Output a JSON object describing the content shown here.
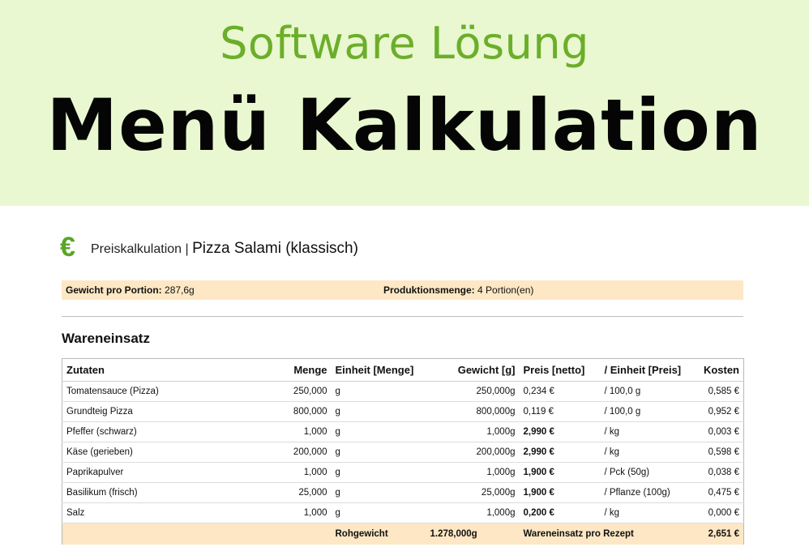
{
  "banner": {
    "subtitle": "Software Lösung",
    "title": "Menü Kalkulation"
  },
  "doc": {
    "icon": "euro-icon",
    "label": "Preiskalkulation",
    "separator": "|",
    "dish": "Pizza Salami (klassisch)"
  },
  "info": {
    "weight_label": "Gewicht pro Portion:",
    "weight_value": "287,6g",
    "production_label": "Produktionsmenge:",
    "production_value": "4 Portion(en)"
  },
  "section_title": "Wareneinsatz",
  "table": {
    "headers": [
      "Zutaten",
      "Menge",
      "Einheit [Menge]",
      "Gewicht [g]",
      "Preis [netto]",
      "/ Einheit [Preis]",
      "Kosten"
    ],
    "rows": [
      {
        "zutat": "Tomatensauce (Pizza)",
        "menge": "250,000",
        "einheit": "g",
        "gewicht": "250,000g",
        "preis": "0,234 €",
        "preis_bold": false,
        "einheit_preis": "/ 100,0 g",
        "kosten": "0,585 €"
      },
      {
        "zutat": "Grundteig Pizza",
        "menge": "800,000",
        "einheit": "g",
        "gewicht": "800,000g",
        "preis": "0,119 €",
        "preis_bold": false,
        "einheit_preis": "/ 100,0 g",
        "kosten": "0,952 €"
      },
      {
        "zutat": "Pfeffer (schwarz)",
        "menge": "1,000",
        "einheit": "g",
        "gewicht": "1,000g",
        "preis": "2,990 €",
        "preis_bold": true,
        "einheit_preis": "/ kg",
        "kosten": "0,003 €"
      },
      {
        "zutat": "Käse (gerieben)",
        "menge": "200,000",
        "einheit": "g",
        "gewicht": "200,000g",
        "preis": "2,990 €",
        "preis_bold": true,
        "einheit_preis": "/ kg",
        "kosten": "0,598 €"
      },
      {
        "zutat": "Paprikapulver",
        "menge": "1,000",
        "einheit": "g",
        "gewicht": "1,000g",
        "preis": "1,900 €",
        "preis_bold": true,
        "einheit_preis": "/ Pck (50g)",
        "kosten": "0,038 €"
      },
      {
        "zutat": "Basilikum (frisch)",
        "menge": "25,000",
        "einheit": "g",
        "gewicht": "25,000g",
        "preis": "1,900 €",
        "preis_bold": true,
        "einheit_preis": "/ Pflanze (100g)",
        "kosten": "0,475 €"
      },
      {
        "zutat": "Salz",
        "menge": "1,000",
        "einheit": "g",
        "gewicht": "1,000g",
        "preis": "0,200 €",
        "preis_bold": true,
        "einheit_preis": "/ kg",
        "kosten": "0,000 €"
      }
    ],
    "footer": {
      "rohgewicht_label": "Rohgewicht",
      "rohgewicht_value": "1.278,000g",
      "wareneinsatz_label": "Wareneinsatz pro Rezept",
      "wareneinsatz_value": "2,651 €"
    }
  },
  "colors": {
    "banner_bg": "#e9f8d0",
    "accent_green": "#6cae2a",
    "highlight": "#fde7c4"
  }
}
